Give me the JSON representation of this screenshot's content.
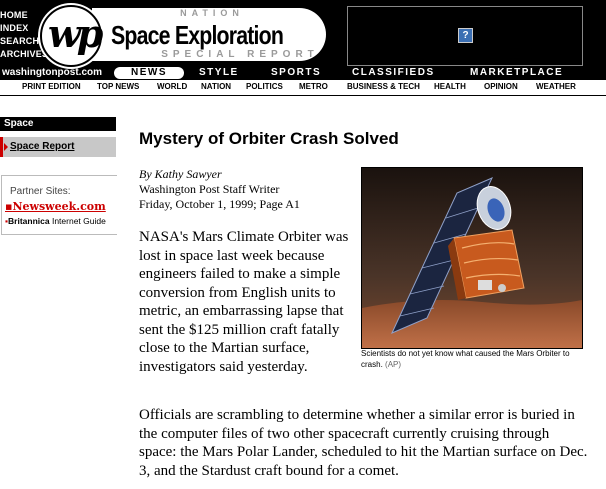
{
  "header": {
    "left_nav": [
      "HOME",
      "INDEX",
      "SEARCH",
      "ARCHIVES"
    ],
    "logo_text": "wp",
    "nation_label": "NATION",
    "section_title": "Space Exploration",
    "special_label": "SPECIAL REPORT",
    "site_url": "washingtonpost.com",
    "ad_placeholder": "?"
  },
  "main_nav": [
    "NEWS",
    "STYLE",
    "SPORTS",
    "CLASSIFIEDS",
    "MARKETPLACE"
  ],
  "sub_nav": [
    "PRINT EDITION",
    "TOP NEWS",
    "WORLD",
    "NATION",
    "POLITICS",
    "METRO",
    "BUSINESS & TECH",
    "HEALTH",
    "OPINION",
    "WEATHER"
  ],
  "sidebar": {
    "section_heading": "Space",
    "active_item": "Space Report",
    "partner_heading": "Partner Sites:",
    "partner_newsweek": "Newsweek.com",
    "partner_britannica": "Britannica",
    "partner_britannica_suffix": "Internet Guide"
  },
  "article": {
    "title": "Mystery of Orbiter Crash Solved",
    "author": "By Kathy Sawyer",
    "author_role": "Washington Post Staff Writer",
    "dateline": "Friday, October 1, 1999; Page A1",
    "lead": "NASA's Mars Climate Orbiter was lost in space last week because engineers failed to make a simple conversion from English units to metric, an embarrassing lapse that sent the $125 million craft fatally close to the Martian surface, investigators said yesterday.",
    "paragraph_2": "Officials are scrambling to determine whether a similar error is buried in the computer files of two other spacecraft currently cruising through space: the Mars Polar Lander, scheduled to hit the Martian surface on Dec. 3, and the Stardust craft bound for a comet.",
    "photo_caption": "Scientists do not yet know what caused the Mars Orbiter to crash.",
    "photo_credit": "(AP)"
  }
}
